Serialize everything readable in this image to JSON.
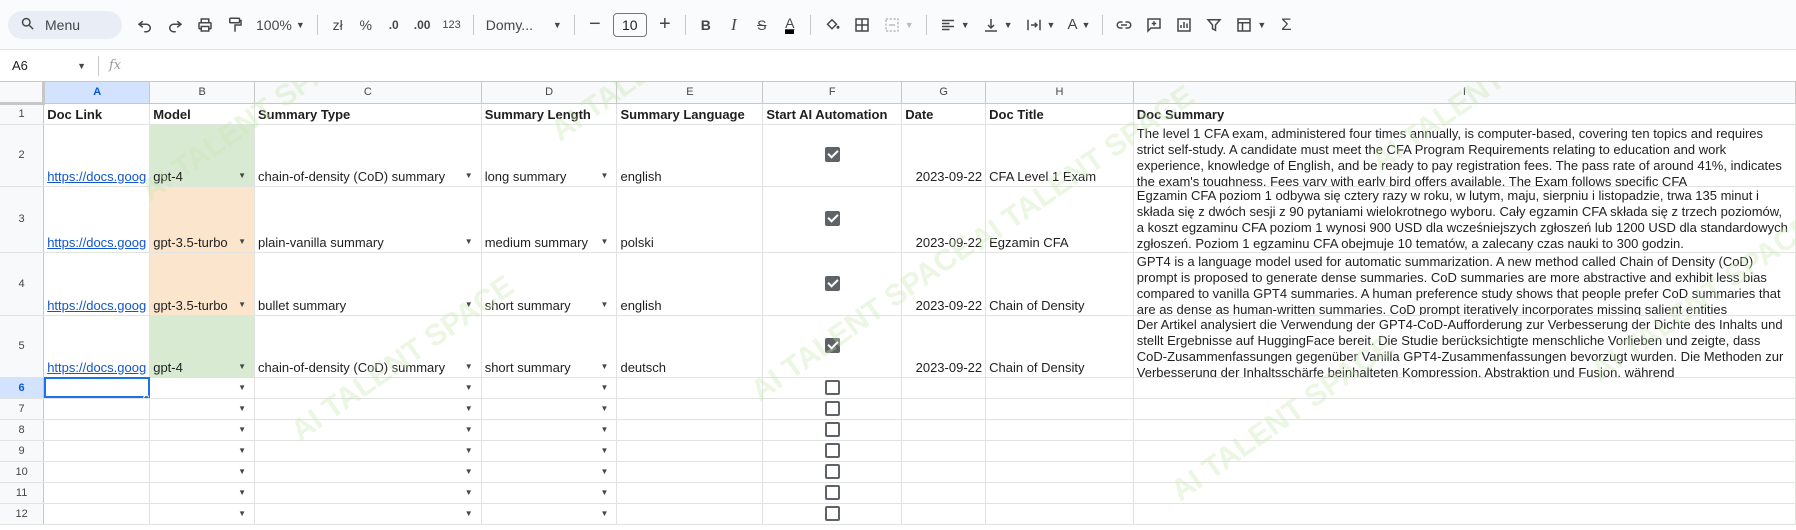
{
  "toolbar": {
    "menu_label": "Menu",
    "zoom": "100%",
    "currency": "zł",
    "percent": "%",
    "dec_less": ".0",
    "dec_more": ".00",
    "number_format": "123",
    "font": "Domy...",
    "font_size": "10"
  },
  "formula_bar": {
    "cell_ref": "A6",
    "fx": "fx",
    "content": ""
  },
  "columns": [
    "A",
    "B",
    "C",
    "D",
    "E",
    "F",
    "G",
    "H",
    "I"
  ],
  "headers": {
    "doc_link": "Doc Link",
    "model": "Model",
    "summary_type": "Summary Type",
    "summary_length": "Summary Length",
    "summary_language": "Summary Language",
    "start": "Start AI Automation",
    "date": "Date",
    "doc_title": "Doc Title",
    "doc_summary": "Doc Summary"
  },
  "rows": [
    {
      "num": "2",
      "link": "https://docs.goog",
      "model": "gpt-4",
      "type": "chain-of-density (CoD) summary",
      "length": "long summary",
      "language": "english",
      "date": "2023-09-22",
      "title": "CFA Level 1 Exam",
      "summary": "The level 1 CFA exam, administered four times annually, is computer-based, covering ten topics and requires strict self-study. A candidate must meet the CFA Program Requirements relating to education and work experience, knowledge of English, and be ready to pay registration fees. The pass rate of around 41%, indicates the exam's toughness. Fees vary with early bird offers available. The Exam follows specific CFA"
    },
    {
      "num": "3",
      "link": "https://docs.goog",
      "model": "gpt-3.5-turbo",
      "type": "plain-vanilla summary",
      "length": "medium summary",
      "language": "polski",
      "date": "2023-09-22",
      "title": "Egzamin CFA",
      "summary": "Egzamin CFA poziom 1 odbywa się cztery razy w roku, w lutym, maju, sierpniu i listopadzie, trwa 135 minut i składa się z dwóch sesji z 90 pytaniami wielokrotnego wyboru. Cały egzamin CFA składa się z trzech poziomów, a koszt egzaminu CFA poziom 1 wynosi 900 USD dla wcześniejszych zgłoszeń lub 1200 USD dla standardowych zgłoszeń. Poziom 1 egzaminu CFA obejmuje 10 tematów, a zalecany czas nauki to 300 godzin."
    },
    {
      "num": "4",
      "link": "https://docs.goog",
      "model": "gpt-3.5-turbo",
      "type": "bullet summary",
      "length": "short summary",
      "language": "english",
      "date": "2023-09-22",
      "title": "Chain of Density",
      "summary": "GPT4 is a language model used for automatic summarization. A new method called Chain of Density (CoD) prompt is proposed to generate dense summaries. CoD summaries are more abstractive and exhibit less bias compared to vanilla GPT4 summaries. A human preference study shows that people prefer CoD summaries that are as dense as human-written summaries. CoD prompt iteratively incorporates missing salient entities"
    },
    {
      "num": "5",
      "link": "https://docs.goog",
      "model": "gpt-4",
      "type": "chain-of-density (CoD) summary",
      "length": "short summary",
      "language": "deutsch",
      "date": "2023-09-22",
      "title": "Chain of Density",
      "summary": "Der Artikel analysiert die Verwendung der GPT4-CoD-Aufforderung zur Verbesserung der Dichte des Inhalts und stellt Ergebnisse auf HuggingFace bereit. Die Studie berücksichtigte menschliche Vorlieben und zeigte, dass CoD-Zusammenfassungen gegenüber Vanilla GPT4-Zusammenfassungen bevorzugt wurden. Die Methoden zur Verbesserung der Inhaltsschärfe beinhalteten Kompression, Abstraktion und Fusion, während"
    }
  ],
  "empty_rows": [
    "6",
    "7",
    "8",
    "9",
    "10",
    "11",
    "12"
  ],
  "watermark": "AI TALENT SPACE"
}
